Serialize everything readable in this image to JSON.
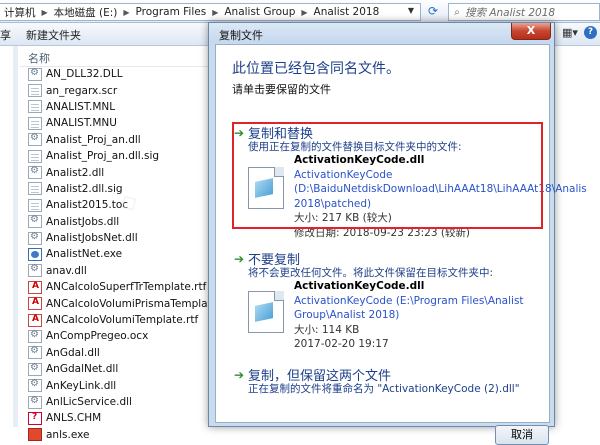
{
  "address": {
    "crumbs": [
      "计算机",
      "本地磁盘 (E:)",
      "Program Files",
      "Analist Group",
      "Analist 2018"
    ],
    "search_placeholder": "搜索 Analist 2018"
  },
  "toolbar": {
    "left": "享",
    "new_folder": "新建文件夹"
  },
  "file_list": {
    "column_name": "名称",
    "files": [
      {
        "name": "AN_DLL32.DLL",
        "icon": "gear"
      },
      {
        "name": "an_regarx.scr",
        "icon": "doc"
      },
      {
        "name": "ANALIST.MNL",
        "icon": "doc"
      },
      {
        "name": "ANALIST.MNU",
        "icon": "doc"
      },
      {
        "name": "Analist_Proj_an.dll",
        "icon": "gear"
      },
      {
        "name": "Analist_Proj_an.dll.sig",
        "icon": "doc"
      },
      {
        "name": "Analist2.dll",
        "icon": "gear"
      },
      {
        "name": "Analist2.dll.sig",
        "icon": "doc"
      },
      {
        "name": "Analist2015.toc",
        "icon": "doc"
      },
      {
        "name": "AnalistJobs.dll",
        "icon": "gear"
      },
      {
        "name": "AnalistJobsNet.dll",
        "icon": "gear"
      },
      {
        "name": "AnalistNet.exe",
        "icon": "net"
      },
      {
        "name": "anav.dll",
        "icon": "gear"
      },
      {
        "name": "ANCalcoloSuperfTrTemplate.rtf",
        "icon": "pdf"
      },
      {
        "name": "ANCalcoloVolumiPrismaTemplate.rtf",
        "icon": "pdf"
      },
      {
        "name": "ANCalcoloVolumiTemplate.rtf",
        "icon": "pdf"
      },
      {
        "name": "AnCompPregeo.ocx",
        "icon": "gear"
      },
      {
        "name": "AnGdal.dll",
        "icon": "gear"
      },
      {
        "name": "AnGdalNet.dll",
        "icon": "gear"
      },
      {
        "name": "AnKeyLink.dll",
        "icon": "gear"
      },
      {
        "name": "AnlLicService.dll",
        "icon": "gear"
      },
      {
        "name": "ANLS.CHM",
        "icon": "chm"
      },
      {
        "name": "anls.exe",
        "icon": "exe"
      }
    ]
  },
  "dialog": {
    "title": "复制文件",
    "close_label": "X",
    "heading": "此位置已经包含同名文件。",
    "subheading": "请单击要保留的文件",
    "options": [
      {
        "title": "复制和替换",
        "desc": "使用正在复制的文件替换目标文件夹中的文件:",
        "file_name": "ActivationKeyCode.dll",
        "path_lines": [
          "ActivationKeyCode",
          "(D:\\BaiduNetdiskDownload\\LihAAAt18\\LihAAAt18\\Analis",
          "2018\\patched)"
        ],
        "size": "大小: 217 KB (较大)",
        "date": "修改日期: 2018-09-23 23:23 (较新)"
      },
      {
        "title": "不要复制",
        "desc": "将不会更改任何文件。将此文件保留在目标文件夹中:",
        "file_name": "ActivationKeyCode.dll",
        "path_lines": [
          "ActivationKeyCode (E:\\Program Files\\Analist",
          "Group\\Analist 2018)"
        ],
        "size": "大小: 114 KB",
        "date": "2017-02-20 19:17"
      },
      {
        "title": "复制，但保留这两个文件",
        "desc": "正在复制的文件将重命名为 \"ActivationKeyCode (2).dll\""
      }
    ],
    "cancel_label": "取消"
  },
  "colors": {
    "accent_blue": "#1d3f8a",
    "highlight_red": "#e0232a",
    "link_blue": "#2a52c9"
  }
}
